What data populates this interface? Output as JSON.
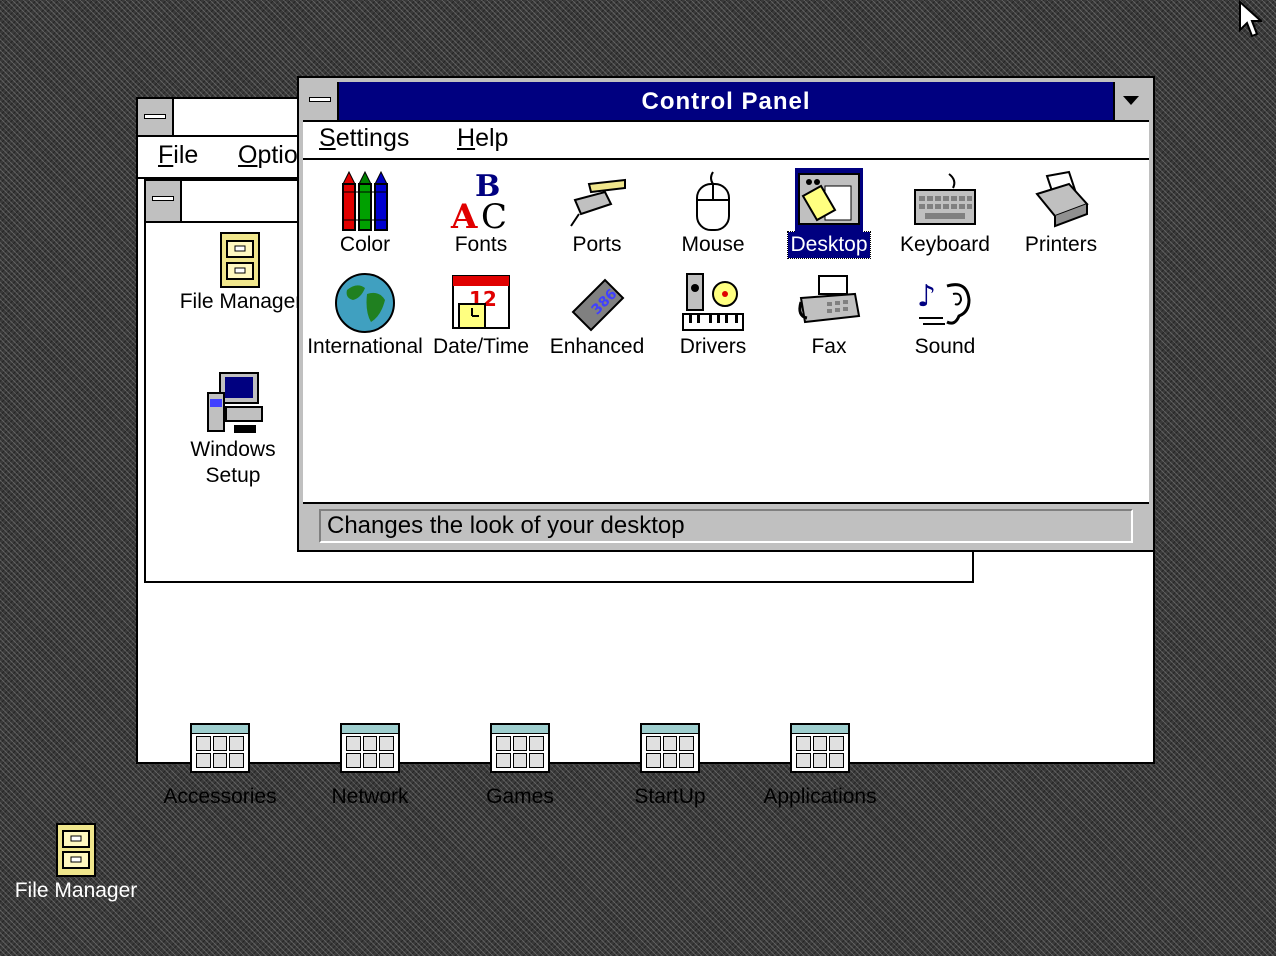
{
  "program_manager": {
    "menu": [
      {
        "label": "File",
        "accel": "F"
      },
      {
        "label": "Optio",
        "accel": "O"
      }
    ],
    "main_group": {
      "items": [
        {
          "label": "File Manager",
          "icon": "file-cabinet-icon"
        },
        {
          "label_line1": "Windows",
          "label_line2": "Setup",
          "icon": "computer-setup-icon"
        }
      ]
    },
    "groups": [
      {
        "label": "Accessories",
        "icon": "program-group-icon"
      },
      {
        "label": "Network",
        "icon": "program-group-icon"
      },
      {
        "label": "Games",
        "icon": "program-group-icon"
      },
      {
        "label": "StartUp",
        "icon": "program-group-icon"
      },
      {
        "label": "Applications",
        "icon": "program-group-icon"
      }
    ]
  },
  "control_panel": {
    "title": "Control Panel",
    "menu": [
      {
        "label": "Settings",
        "accel": "S"
      },
      {
        "label": "Help",
        "accel": "H"
      }
    ],
    "icons": [
      {
        "label": "Color",
        "icon": "crayons-icon"
      },
      {
        "label": "Fonts",
        "icon": "fonts-icon"
      },
      {
        "label": "Ports",
        "icon": "port-connector-icon"
      },
      {
        "label": "Mouse",
        "icon": "mouse-icon"
      },
      {
        "label": "Desktop",
        "icon": "desktop-icon",
        "selected": true
      },
      {
        "label": "Keyboard",
        "icon": "keyboard-icon"
      },
      {
        "label": "Printers",
        "icon": "printer-icon"
      },
      {
        "label": "International",
        "icon": "globe-icon"
      },
      {
        "label": "Date/Time",
        "icon": "calendar-clock-icon"
      },
      {
        "label": "Enhanced",
        "icon": "chip-386-icon"
      },
      {
        "label": "Drivers",
        "icon": "drivers-icon"
      },
      {
        "label": "Fax",
        "icon": "fax-icon"
      },
      {
        "label": "Sound",
        "icon": "sound-ear-icon"
      }
    ],
    "status": "Changes the look of your desktop"
  },
  "desktop": {
    "minimized_icons": [
      {
        "label": "File Manager",
        "icon": "file-cabinet-icon"
      }
    ]
  },
  "colors": {
    "titlebar_active": "#000080",
    "selection": "#000080",
    "window_bg": "#ffffff",
    "frame": "#c0c0c0"
  }
}
